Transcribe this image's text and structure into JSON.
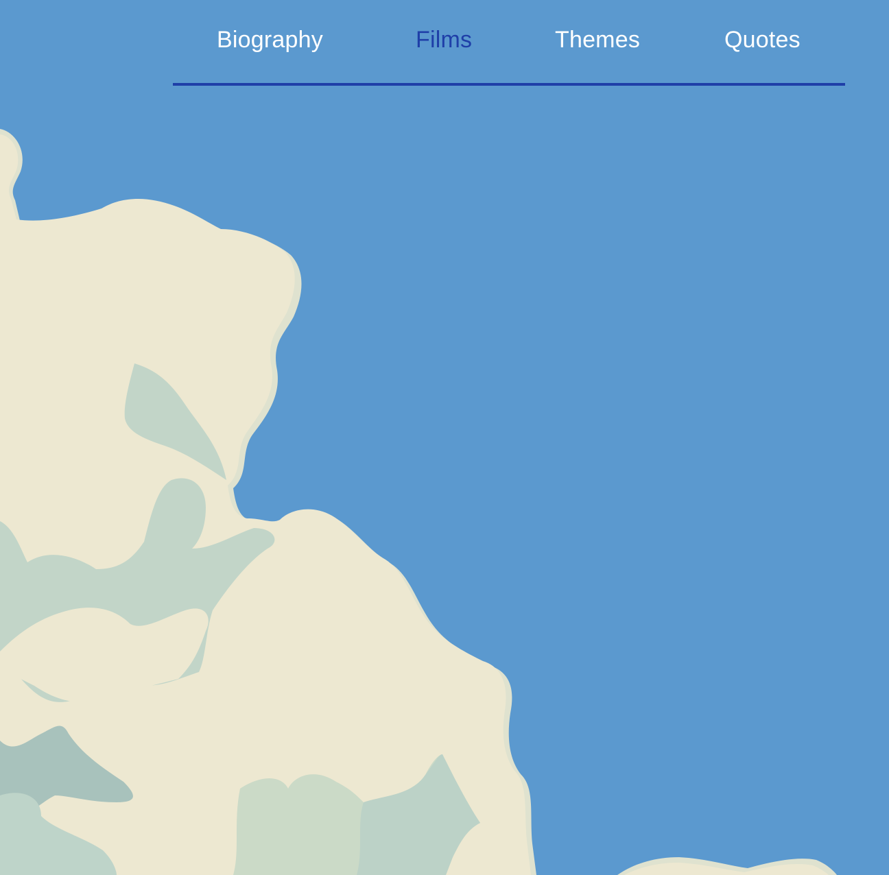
{
  "nav": {
    "items": [
      {
        "label": "Biography",
        "active": false
      },
      {
        "label": "Films",
        "active": true
      },
      {
        "label": "Themes",
        "active": false
      },
      {
        "label": "Quotes",
        "active": false
      }
    ]
  },
  "colors": {
    "water": "#5b99cf",
    "land": "#ede8d1",
    "land_edge": "#dfe2cf",
    "terrain_green": "#c2d5c8",
    "terrain_dark": "#a8c2bc",
    "nav_text": "#ffffff",
    "nav_active": "#1f3fa8",
    "nav_rule": "#1f3fa8"
  },
  "background": {
    "type": "map",
    "icon": "map-illustration"
  }
}
